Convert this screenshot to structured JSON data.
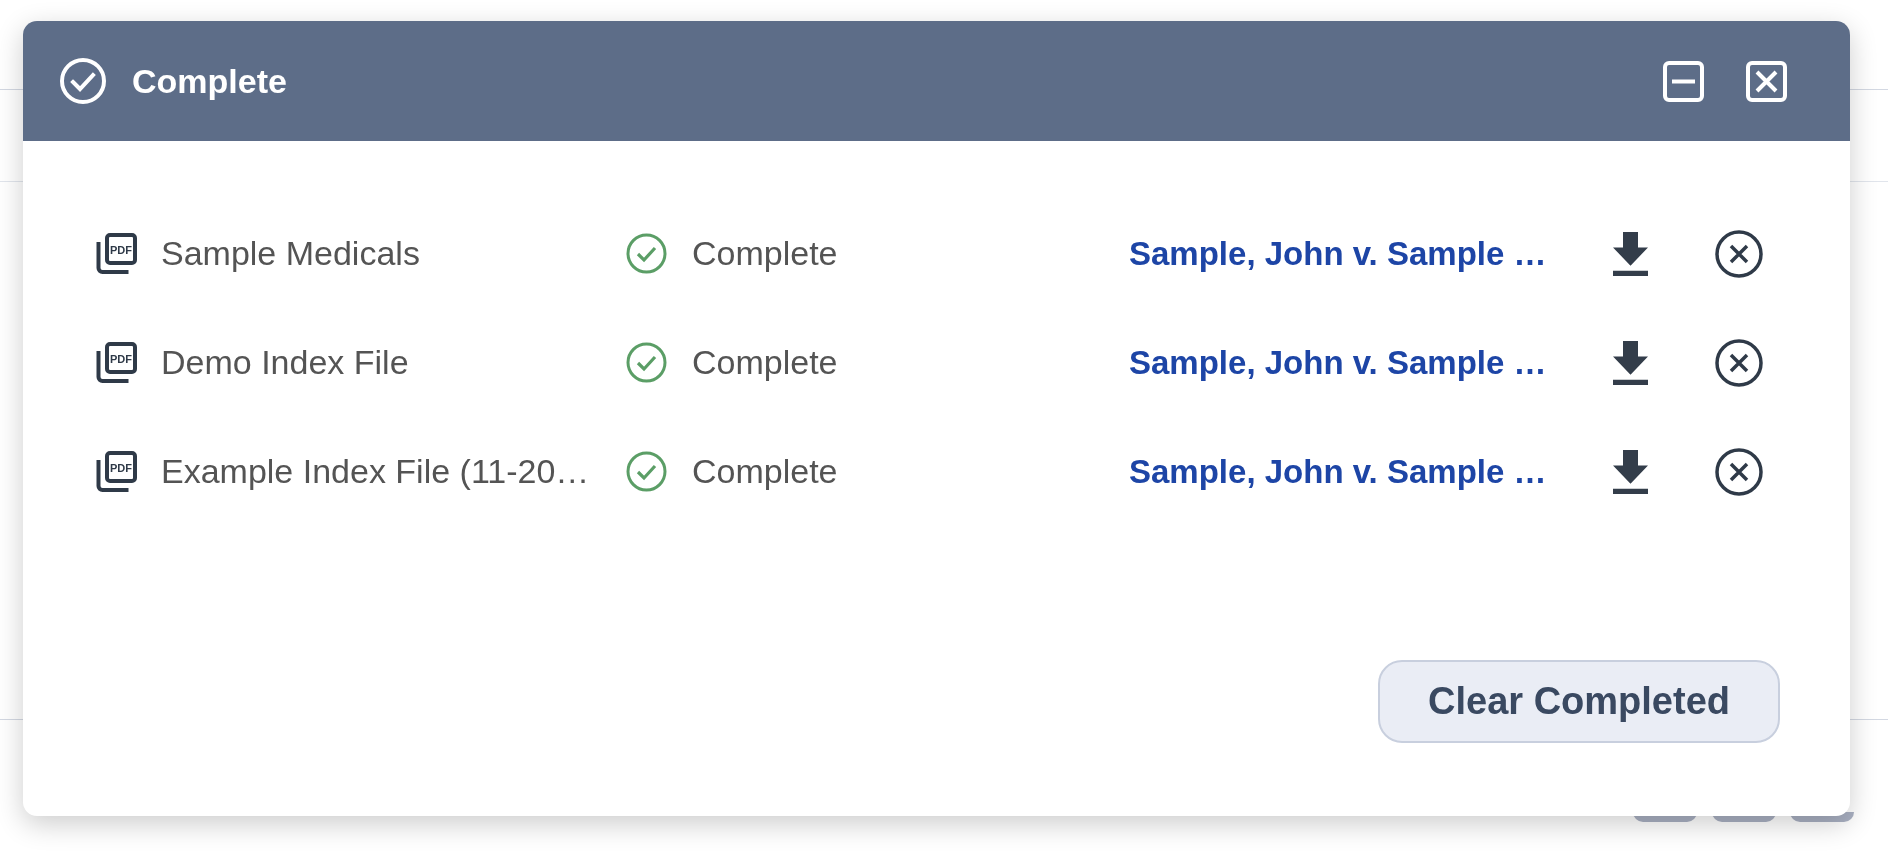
{
  "window": {
    "title": "Complete",
    "controls": [
      {
        "kind": "minimize"
      },
      {
        "kind": "close"
      }
    ]
  },
  "files": [
    {
      "type_label": "PDF",
      "name": "Sample Medicals",
      "complete": true,
      "status": "Complete",
      "matter": "Sample, John v. Sample …"
    },
    {
      "type_label": "PDF",
      "name": "Demo Index File",
      "complete": true,
      "status": "Complete",
      "matter": "Sample, John v. Sample …"
    },
    {
      "type_label": "PDF",
      "name": "Example Index File (11-20…",
      "complete": true,
      "status": "Complete",
      "matter": "Sample, John v. Sample …"
    }
  ],
  "footer": {
    "clear_button": "Clear Completed"
  }
}
